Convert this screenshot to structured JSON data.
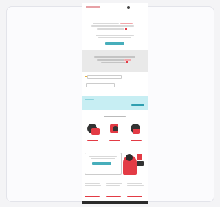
{
  "header": {
    "logo_text": "",
    "nav_text": ""
  },
  "hero": {
    "title": "",
    "subtitle": "",
    "cta": ""
  },
  "section2": {
    "title": "",
    "cta": ""
  },
  "inputs": {
    "field1_placeholder": "",
    "field2_placeholder": ""
  },
  "banner": {
    "text": "",
    "cta": ""
  },
  "benefits": {
    "title": "",
    "items": [
      {
        "label": ""
      },
      {
        "label": ""
      },
      {
        "label": ""
      }
    ]
  },
  "promo": {
    "title": "",
    "cta": ""
  },
  "bottom": {
    "columns": [
      {
        "title": "",
        "text": ""
      },
      {
        "title": "",
        "text": ""
      },
      {
        "title": "",
        "text": ""
      }
    ]
  },
  "colors": {
    "accent": "#e33b45",
    "teal": "#47aebb",
    "banner": "#c7eef3",
    "gray": "#e9e9e9"
  }
}
